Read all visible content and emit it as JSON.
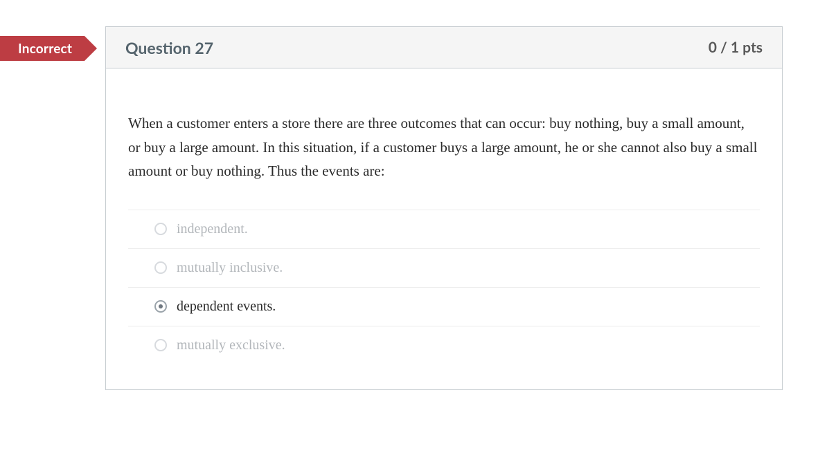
{
  "status": "Incorrect",
  "header": {
    "title": "Question 27",
    "points": "0 / 1 pts"
  },
  "question_text": "When a customer enters a store there are three outcomes that can occur: buy nothing, buy a small amount, or buy a large amount. In this situation, if a customer buys a large amount, he or she cannot also buy a small amount or buy nothing. Thus the events are:",
  "answers": [
    {
      "label": "independent.",
      "selected": false
    },
    {
      "label": "mutually inclusive.",
      "selected": false
    },
    {
      "label": "dependent events.",
      "selected": true
    },
    {
      "label": "mutually exclusive.",
      "selected": false
    }
  ]
}
